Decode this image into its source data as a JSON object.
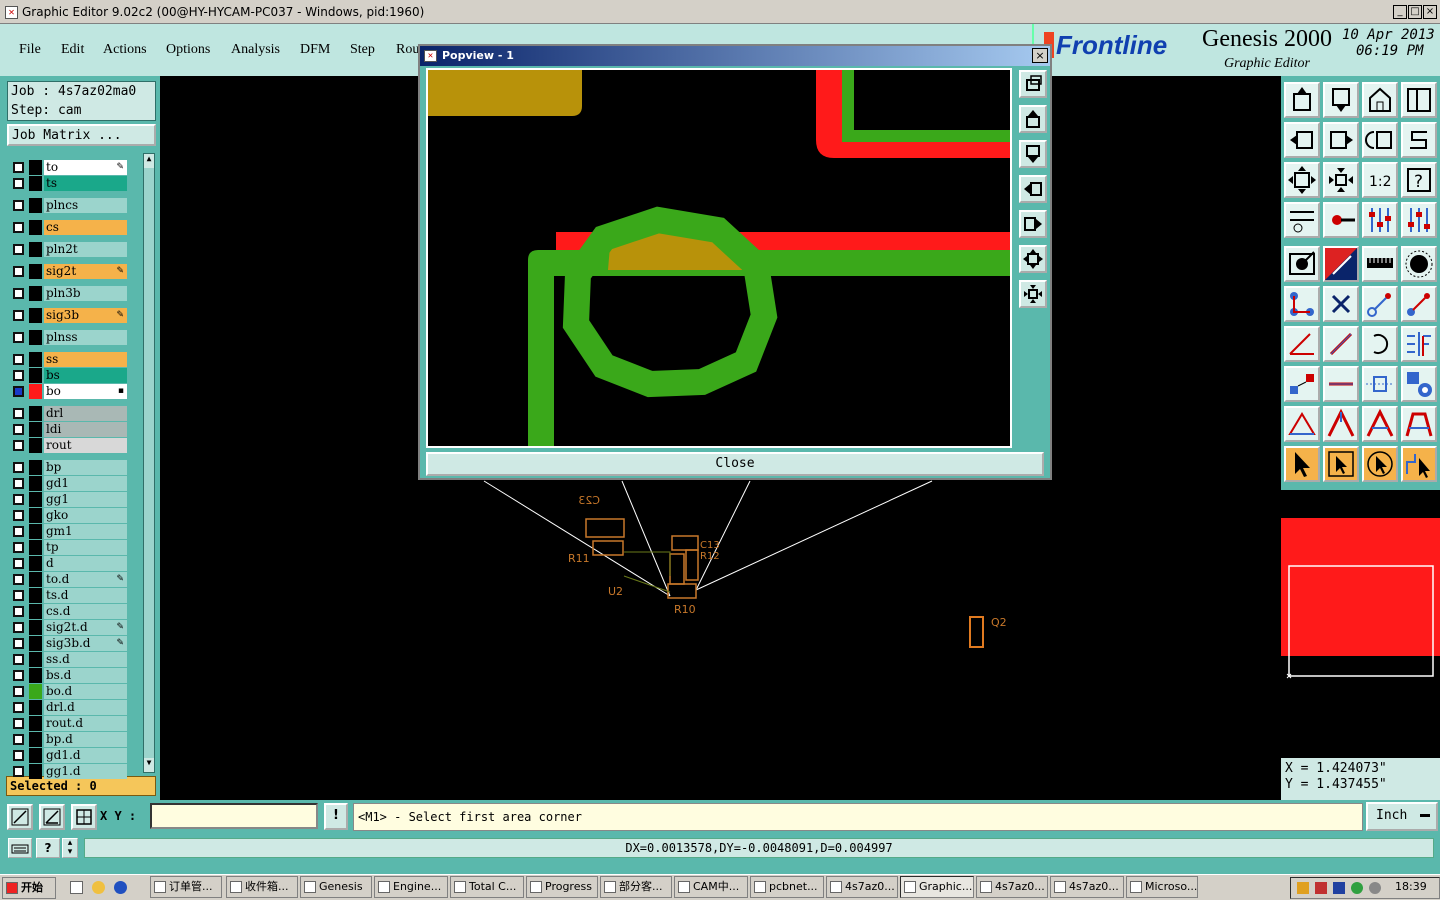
{
  "window": {
    "title": "Graphic Editor 9.02c2 (00@HY-HYCAM-PC037 - Windows, pid:1960)",
    "controls": [
      "_",
      "□",
      "×"
    ]
  },
  "menu": [
    "File",
    "Edit",
    "Actions",
    "Options",
    "Analysis",
    "DFM",
    "Step",
    "Rou"
  ],
  "brand": {
    "logo": "Frontline",
    "product": "Genesis 2000",
    "subtitle": "Graphic Editor",
    "date": "10 Apr 2013",
    "time": "06:19 PM"
  },
  "job": {
    "job_line": "Job : 4s7az02ma0",
    "step_line": "Step: cam",
    "matrix_button": "Job Matrix ..."
  },
  "layers": [
    {
      "name": "to",
      "color": "#ffffff",
      "mark": "✎"
    },
    {
      "name": "ts",
      "color": "#1aa88a",
      "mark": ""
    },
    {
      "name": "plncs",
      "color": "#9bd4cc",
      "mark": ""
    },
    {
      "name": "cs",
      "color": "#f5b24a",
      "mark": ""
    },
    {
      "name": "pln2t",
      "color": "#9bd4cc",
      "mark": ""
    },
    {
      "name": "sig2t",
      "color": "#f5b24a",
      "mark": "✎"
    },
    {
      "name": "pln3b",
      "color": "#9bd4cc",
      "mark": ""
    },
    {
      "name": "sig3b",
      "color": "#f5b24a",
      "mark": "✎"
    },
    {
      "name": "plnss",
      "color": "#9bd4cc",
      "mark": ""
    },
    {
      "name": "ss",
      "color": "#f5b24a",
      "mark": ""
    },
    {
      "name": "bs",
      "color": "#1aa88a",
      "mark": ""
    },
    {
      "name": "bo",
      "color": "#ffffff",
      "mark": "▪"
    },
    {
      "name": "drl",
      "color": "#a9b8b5",
      "mark": ""
    },
    {
      "name": "ldi",
      "color": "#a9b8b5",
      "mark": ""
    },
    {
      "name": "rout",
      "color": "#d8d8d8",
      "mark": ""
    },
    {
      "name": "bp",
      "color": "#9bd4cc",
      "mark": ""
    },
    {
      "name": "gd1",
      "color": "#9bd4cc",
      "mark": ""
    },
    {
      "name": "gg1",
      "color": "#9bd4cc",
      "mark": ""
    },
    {
      "name": "gko",
      "color": "#9bd4cc",
      "mark": ""
    },
    {
      "name": "gm1",
      "color": "#9bd4cc",
      "mark": ""
    },
    {
      "name": "tp",
      "color": "#9bd4cc",
      "mark": ""
    },
    {
      "name": "d",
      "color": "#9bd4cc",
      "mark": ""
    },
    {
      "name": "to.d",
      "color": "#9bd4cc",
      "mark": "✎"
    },
    {
      "name": "ts.d",
      "color": "#9bd4cc",
      "mark": ""
    },
    {
      "name": "cs.d",
      "color": "#9bd4cc",
      "mark": ""
    },
    {
      "name": "sig2t.d",
      "color": "#9bd4cc",
      "mark": "✎"
    },
    {
      "name": "sig3b.d",
      "color": "#9bd4cc",
      "mark": "✎"
    },
    {
      "name": "ss.d",
      "color": "#9bd4cc",
      "mark": ""
    },
    {
      "name": "bs.d",
      "color": "#9bd4cc",
      "mark": ""
    },
    {
      "name": "bo.d",
      "color": "#9bd4cc",
      "mark": ""
    },
    {
      "name": "drl.d",
      "color": "#9bd4cc",
      "mark": ""
    },
    {
      "name": "rout.d",
      "color": "#9bd4cc",
      "mark": ""
    },
    {
      "name": "bp.d",
      "color": "#9bd4cc",
      "mark": ""
    },
    {
      "name": "gd1.d",
      "color": "#9bd4cc",
      "mark": ""
    },
    {
      "name": "gg1.d",
      "color": "#9bd4cc",
      "mark": ""
    }
  ],
  "selected": "Selected : 0",
  "popview": {
    "title": "Popview - 1",
    "close_label": "Close",
    "close_x": "×"
  },
  "canvas_labels": {
    "c23": "C23",
    "r11": "R11",
    "c13": "C13",
    "r12": "R12",
    "u2": "U2",
    "r10": "R10",
    "q2": "Q2"
  },
  "statusbar": {
    "xy_label": "X Y :",
    "xy_value": "",
    "bang": "!",
    "prompt": "<M1> - Select first area corner",
    "unit": "Inch"
  },
  "coords": {
    "x": "X = 1.424073\"",
    "y": "Y = 1.437455\""
  },
  "measure": "DX=0.0013578,DY=-0.0048091,D=0.004997",
  "taskbar": {
    "start": "开始",
    "tasks": [
      "订单管...",
      "收件箱...",
      "Genesis",
      "Engine...",
      "Total C...",
      "Progress",
      "部分客...",
      "CAM中...",
      "pcbnet...",
      "4s7az0...",
      "Graphic...",
      "4s7az0...",
      "4s7az0...",
      "Microso..."
    ],
    "clock": "18:39"
  }
}
